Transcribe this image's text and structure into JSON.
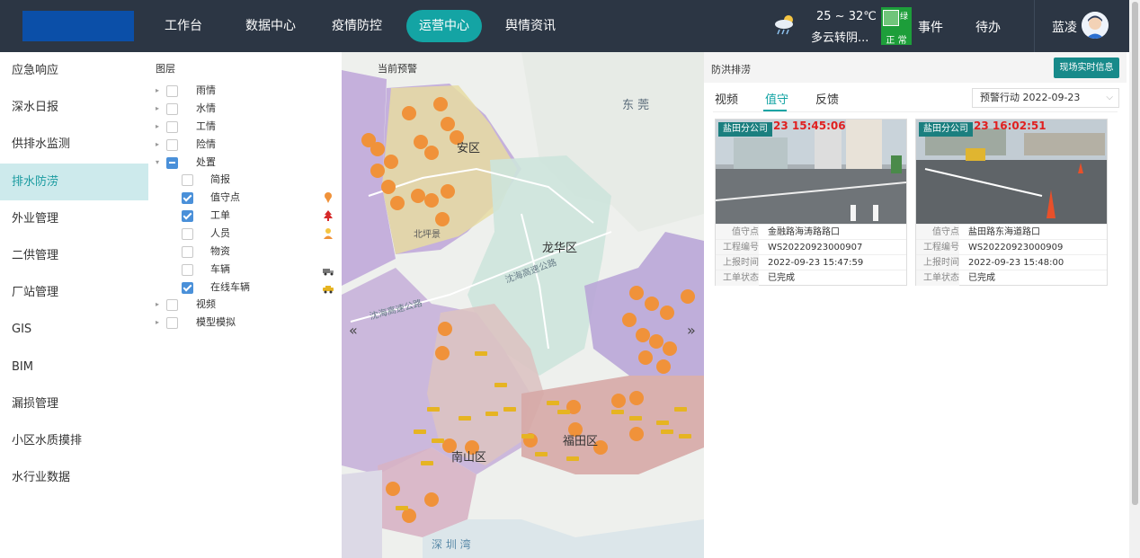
{
  "nav": {
    "items": [
      {
        "label": "工作台",
        "active": false
      },
      {
        "label": "数据中心",
        "active": false
      },
      {
        "label": "疫情防控",
        "active": false
      },
      {
        "label": "运营中心",
        "active": true
      },
      {
        "label": "舆情资讯",
        "active": false
      }
    ]
  },
  "weather": {
    "temp": "25 ~ 32℃",
    "desc": "多云转阴...",
    "icon": "cloud-rain-icon"
  },
  "health_code": {
    "tag": "绿",
    "status": "正 常",
    "color": "#1d9e3a"
  },
  "topbar": {
    "events_label": "事件",
    "todo_label": "待办",
    "user_name": "蓝凌"
  },
  "sidebar": {
    "items": [
      {
        "label": "应急响应",
        "active": false
      },
      {
        "label": "深水日报",
        "active": false
      },
      {
        "label": "供排水监测",
        "active": false
      },
      {
        "label": "排水防涝",
        "active": true
      },
      {
        "label": "外业管理",
        "active": false
      },
      {
        "label": "二供管理",
        "active": false
      },
      {
        "label": "厂站管理",
        "active": false
      },
      {
        "label": "GIS",
        "active": false
      },
      {
        "label": "BIM",
        "active": false
      },
      {
        "label": "漏损管理",
        "active": false
      },
      {
        "label": "小区水质摸排",
        "active": false
      },
      {
        "label": "水行业数据",
        "active": false
      }
    ]
  },
  "layers": {
    "title": "图层",
    "tree": [
      {
        "label": "雨情",
        "level": 0,
        "state": "off",
        "expand": "closed"
      },
      {
        "label": "水情",
        "level": 0,
        "state": "off",
        "expand": "closed"
      },
      {
        "label": "工情",
        "level": 0,
        "state": "off",
        "expand": "closed"
      },
      {
        "label": "险情",
        "level": 0,
        "state": "off",
        "expand": "closed"
      },
      {
        "label": "处置",
        "level": 0,
        "state": "part",
        "expand": "open"
      },
      {
        "label": "简报",
        "level": 1,
        "state": "off",
        "icon": ""
      },
      {
        "label": "值守点",
        "level": 1,
        "state": "on",
        "icon": "pin-icon"
      },
      {
        "label": "工单",
        "level": 1,
        "state": "on",
        "icon": "tree-icon"
      },
      {
        "label": "人员",
        "level": 1,
        "state": "off",
        "icon": "person-icon"
      },
      {
        "label": "物资",
        "level": 1,
        "state": "off",
        "icon": ""
      },
      {
        "label": "车辆",
        "level": 1,
        "state": "off",
        "icon": "truck-icon"
      },
      {
        "label": "在线车辆",
        "level": 1,
        "state": "on",
        "icon": "car-icon"
      },
      {
        "label": "视频",
        "level": 0,
        "state": "off",
        "expand": "closed"
      },
      {
        "label": "模型模拟",
        "level": 0,
        "state": "off",
        "expand": "closed"
      }
    ]
  },
  "map": {
    "title": "当前预警",
    "labels": {
      "dongguan": "东 莞",
      "longhua": "龙华区",
      "bao_an": "安区",
      "nanshan": "南山区",
      "futian": "福田区",
      "shenzhenwan": "深 圳 湾",
      "road1": "沈海高速公路",
      "road2": "沈海高速公路",
      "district_top": "安区",
      "dist_mid": "北坪景"
    },
    "prev": "«",
    "next": "»"
  },
  "right_panel": {
    "title": "防洪排涝",
    "live_button": "现场实时信息",
    "tabs": [
      {
        "label": "视频",
        "active": false
      },
      {
        "label": "值守",
        "active": true
      },
      {
        "label": "反馈",
        "active": false
      }
    ],
    "select_value": "预警行动 2022-09-23",
    "cards": [
      {
        "badge": "盐田分公司",
        "stamp": "23 15:45:06",
        "keys": [
          "值守点",
          "工程编号",
          "上报时间",
          "工单状态"
        ],
        "values": [
          "金融路海涛路路口",
          "WS20220923000907",
          "2022-09-23 15:47:59",
          "已完成"
        ]
      },
      {
        "badge": "盐田分公司",
        "stamp": "23 16:02:51",
        "keys": [
          "值守点",
          "工程编号",
          "上报时间",
          "工单状态"
        ],
        "values": [
          "盐田路东海道路口",
          "WS20220923000909",
          "2022-09-23 15:48:00",
          "已完成"
        ]
      }
    ]
  },
  "colors": {
    "accent": "#14a4a4",
    "topbar": "#2c3644",
    "active_side": "#cdeaec"
  }
}
